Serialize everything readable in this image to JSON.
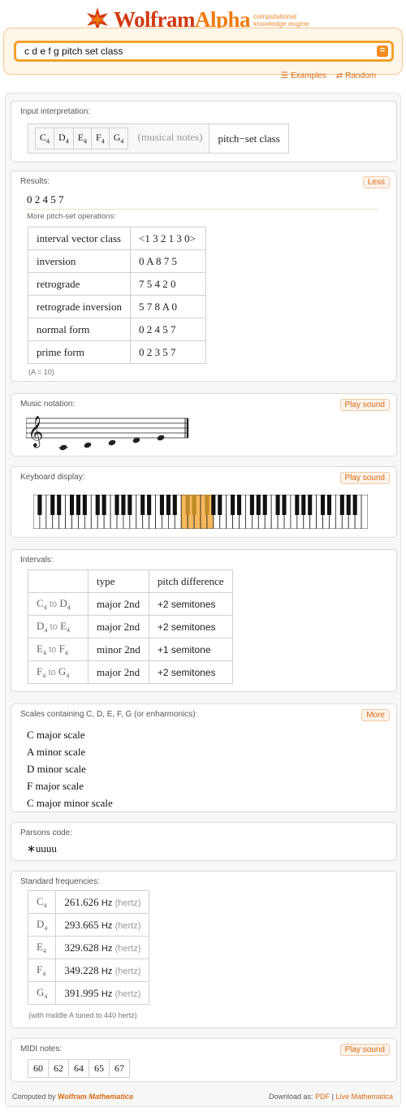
{
  "header": {
    "brand_a": "Wolfram",
    "brand_b": "Alpha",
    "tagline_1": "computational",
    "tagline_2": "knowledge engine",
    "query": "c d e f g pitch set class",
    "examples": "Examples",
    "random": "Random"
  },
  "input": {
    "title": "Input interpretation:",
    "notes": [
      "C",
      "D",
      "E",
      "F",
      "G"
    ],
    "octave": "4",
    "qualifier": "(musical notes)",
    "operation": "pitch−set class"
  },
  "results": {
    "title": "Results:",
    "less": "Less",
    "value": "0 2 4 5 7",
    "sub_title": "More pitch-set operations:",
    "rows": [
      {
        "label": "interval vector class",
        "value": "<1 3 2 1 3 0>"
      },
      {
        "label": "inversion",
        "value": "0 A 8 7 5"
      },
      {
        "label": "retrograde",
        "value": "7 5 4 2 0"
      },
      {
        "label": "retrograde inversion",
        "value": "5 7 8 A 0"
      },
      {
        "label": "normal form",
        "value": "0 2 4 5 7"
      },
      {
        "label": "prime form",
        "value": "0 2 3 5 7"
      }
    ],
    "note": "(A = 10)"
  },
  "notation": {
    "title": "Music notation:",
    "play": "Play sound"
  },
  "keyboard": {
    "title": "Keyboard display:",
    "play": "Play sound",
    "highlight_color": "#f5b85a"
  },
  "intervals": {
    "title": "Intervals:",
    "head_type": "type",
    "head_diff": "pitch difference",
    "to": "to",
    "rows": [
      {
        "a": "C",
        "b": "D",
        "type": "major 2nd",
        "diff": "+2 semitones"
      },
      {
        "a": "D",
        "b": "E",
        "type": "major 2nd",
        "diff": "+2 semitones"
      },
      {
        "a": "E",
        "b": "F",
        "type": "minor 2nd",
        "diff": "+1 semitone"
      },
      {
        "a": "F",
        "b": "G",
        "type": "major 2nd",
        "diff": "+2 semitones"
      }
    ]
  },
  "scales": {
    "title": "Scales containing C, D, E, F, G (or enharmonics):",
    "more": "More",
    "items": [
      "C major scale",
      "A minor scale",
      "D minor scale",
      "F major scale",
      "C major minor scale"
    ]
  },
  "parsons": {
    "title": "Parsons code:",
    "value": "∗uuuu"
  },
  "frequencies": {
    "title": "Standard frequencies:",
    "unit": "Hz",
    "unit_word": "(hertz)",
    "rows": [
      {
        "note": "C",
        "value": "261.626"
      },
      {
        "note": "D",
        "value": "293.665"
      },
      {
        "note": "E",
        "value": "329.628"
      },
      {
        "note": "F",
        "value": "349.228"
      },
      {
        "note": "G",
        "value": "391.995"
      }
    ],
    "note": "(with middle A tuned to 440 hertz)"
  },
  "midi": {
    "title": "MIDI notes:",
    "play": "Play sound",
    "values": [
      "60",
      "62",
      "64",
      "65",
      "67"
    ]
  },
  "footer": {
    "computed": "Computed by",
    "wolfram": "Wolfram",
    "mathematica": "Mathematica",
    "download": "Download as:",
    "pdf": "PDF",
    "sep": "|",
    "live": "Live Mathematica"
  }
}
